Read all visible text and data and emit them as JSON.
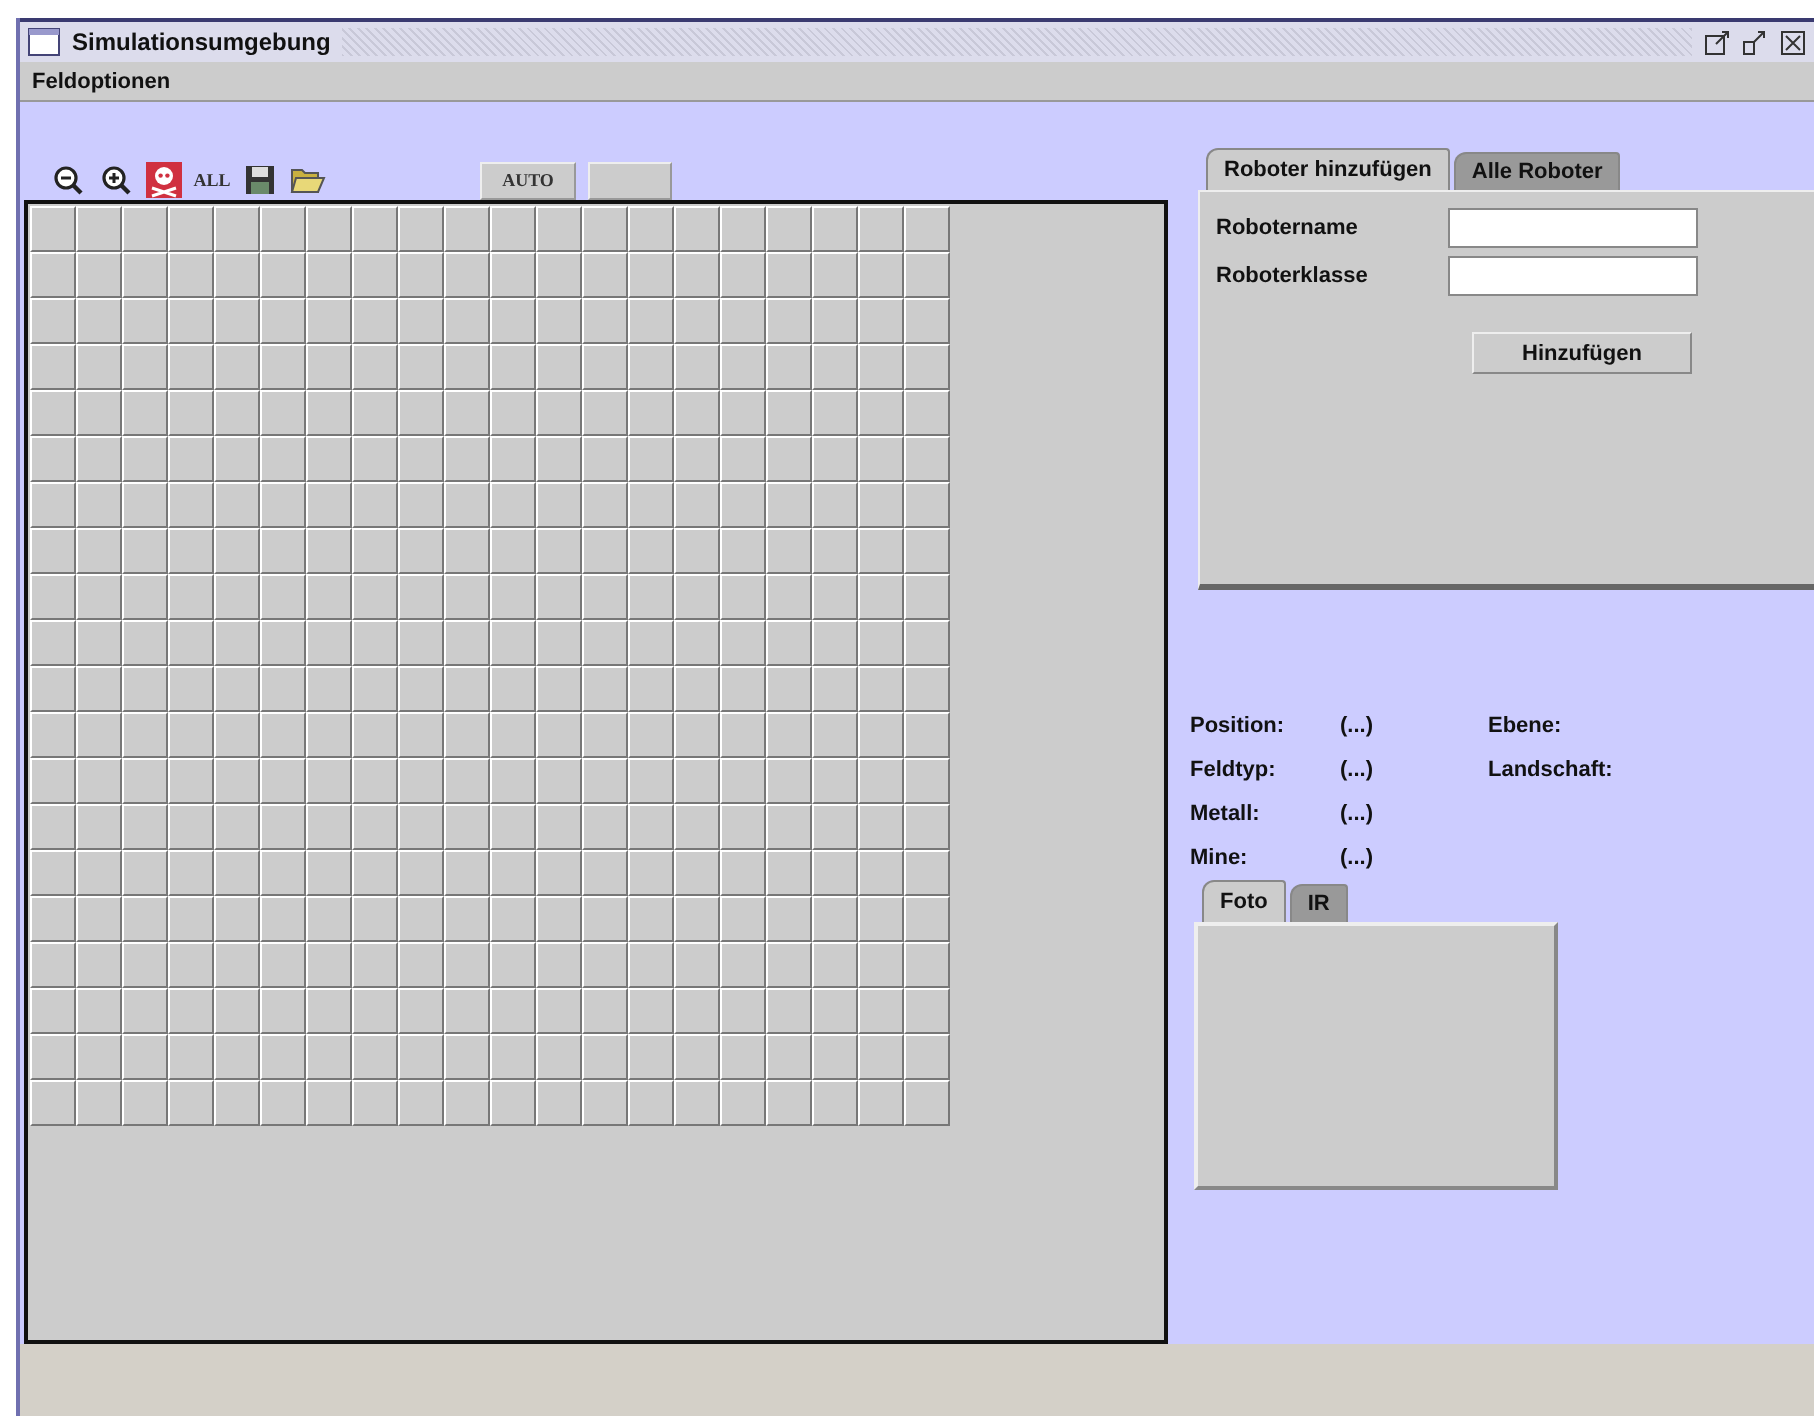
{
  "window": {
    "title": "Simulationsumgebung"
  },
  "menu": [
    "Feldoptionen"
  ],
  "toolbar": [
    {
      "kind": "zoom-out"
    },
    {
      "kind": "zoom-in"
    },
    {
      "kind": "skull"
    },
    {
      "kind": "text",
      "label": "ALL"
    },
    {
      "kind": "save"
    },
    {
      "kind": "open"
    }
  ],
  "mode_buttons": [
    {
      "kind": "text",
      "label": "AUTO"
    },
    {
      "kind": "blank"
    }
  ],
  "robot_tabs": [
    {
      "label": "Roboter hinzufügen",
      "selected": true
    },
    {
      "label": "Alle Roboter",
      "selected": false
    }
  ],
  "robot_form": {
    "fields": [
      {
        "label": "Robotername"
      },
      {
        "label": "Roboterklasse"
      }
    ],
    "submit": "Hinzufügen"
  },
  "info": [
    {
      "label": "Position:",
      "value": "(...)",
      "label_2": "Ebene:"
    },
    {
      "label": "Feldtyp:",
      "value": "(...)",
      "label_2": "Landschaft:"
    },
    {
      "label": "Metall:",
      "value": "(...)"
    },
    {
      "label": "Mine:",
      "value": "(...)"
    }
  ],
  "view_tabs": [
    {
      "label": "Foto",
      "selected": true
    },
    {
      "label": "IR",
      "selected": false
    }
  ]
}
